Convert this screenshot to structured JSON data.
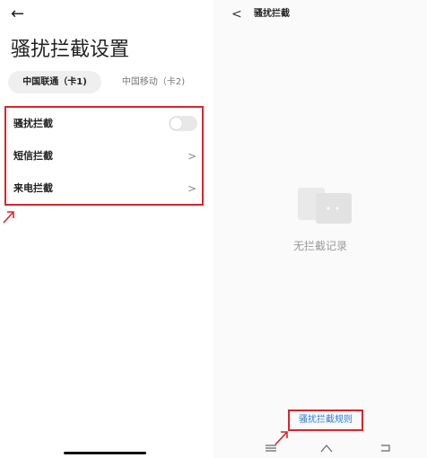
{
  "left": {
    "title": "骚扰拦截设置",
    "tabs": [
      {
        "label": "中国联通（卡1)"
      },
      {
        "label": "中国移动（卡2)"
      }
    ],
    "rows": [
      {
        "label": "骚扰拦截",
        "control": "toggle",
        "enabled": false
      },
      {
        "label": "短信拦截",
        "control": "chevron"
      },
      {
        "label": "来电拦截",
        "control": "chevron"
      }
    ]
  },
  "right": {
    "title": "骚扰拦截",
    "empty_text": "无拦截记录",
    "rules_link": "骚扰拦截规则"
  },
  "icons": {
    "back": "back-arrow-icon",
    "chevron": "chevron-right-icon",
    "menu": "menu-icon",
    "home": "home-icon",
    "back_nav": "back-nav-icon"
  },
  "colors": {
    "highlight": "#d9252b",
    "link": "#2e7bd6"
  }
}
